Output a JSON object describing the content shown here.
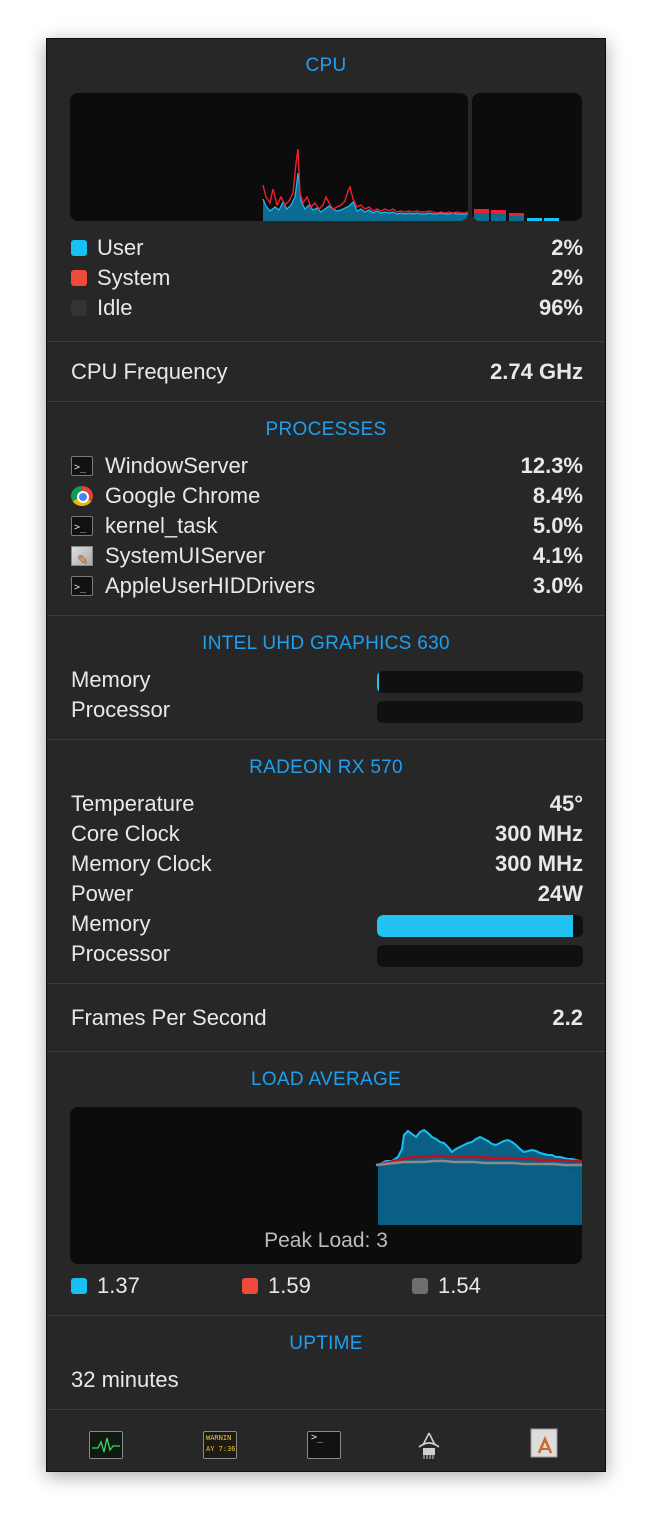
{
  "cpu": {
    "heading": "CPU",
    "legend": [
      {
        "label": "User",
        "value": "2%",
        "color": "#19c0f5"
      },
      {
        "label": "System",
        "value": "2%",
        "color": "#f04a3c"
      },
      {
        "label": "Idle",
        "value": "96%",
        "color": "#333333"
      }
    ]
  },
  "cpu_frequency": {
    "label": "CPU Frequency",
    "value": "2.74 GHz"
  },
  "processes": {
    "heading": "PROCESSES",
    "items": [
      {
        "name": "WindowServer",
        "value": "12.3%",
        "icon": "terminal-icon"
      },
      {
        "name": "Google Chrome",
        "value": "8.4%",
        "icon": "chrome-icon"
      },
      {
        "name": "kernel_task",
        "value": "5.0%",
        "icon": "terminal-icon"
      },
      {
        "name": "SystemUIServer",
        "value": "4.1%",
        "icon": "system-ui-server-icon"
      },
      {
        "name": "AppleUserHIDDrivers",
        "value": "3.0%",
        "icon": "terminal-icon"
      }
    ]
  },
  "intel_gpu": {
    "heading": "INTEL UHD GRAPHICS 630",
    "memory_label": "Memory",
    "memory_fraction": 0.01,
    "processor_label": "Processor",
    "processor_fraction": 0.0
  },
  "radeon_gpu": {
    "heading": "RADEON RX 570",
    "temperature_label": "Temperature",
    "temperature_value": "45°",
    "core_clock_label": "Core Clock",
    "core_clock_value": "300 MHz",
    "memory_clock_label": "Memory Clock",
    "memory_clock_value": "300 MHz",
    "power_label": "Power",
    "power_value": "24W",
    "memory_label": "Memory",
    "memory_fraction": 0.95,
    "processor_label": "Processor",
    "processor_fraction": 0.0
  },
  "fps": {
    "label": "Frames Per Second",
    "value": "2.2"
  },
  "load_average": {
    "heading": "LOAD AVERAGE",
    "peak_load": "Peak Load: 3",
    "values": [
      {
        "value": "1.37",
        "color": "#19c0f5"
      },
      {
        "value": "1.59",
        "color": "#f04a3c"
      },
      {
        "value": "1.54",
        "color": "#6e6e6e"
      }
    ]
  },
  "uptime": {
    "heading": "UPTIME",
    "value": "32 minutes"
  },
  "toolbar": {
    "icons": [
      "activity-monitor-icon",
      "console-icon",
      "terminal-icon",
      "system-information-icon",
      "system-ui-server-icon"
    ],
    "console_text_top": "WARNIN",
    "console_text_bottom": "AY 7:36"
  },
  "colors": {
    "accent": "#1ea0ee",
    "user": "#19c0f5",
    "system": "#f04a3c"
  }
}
